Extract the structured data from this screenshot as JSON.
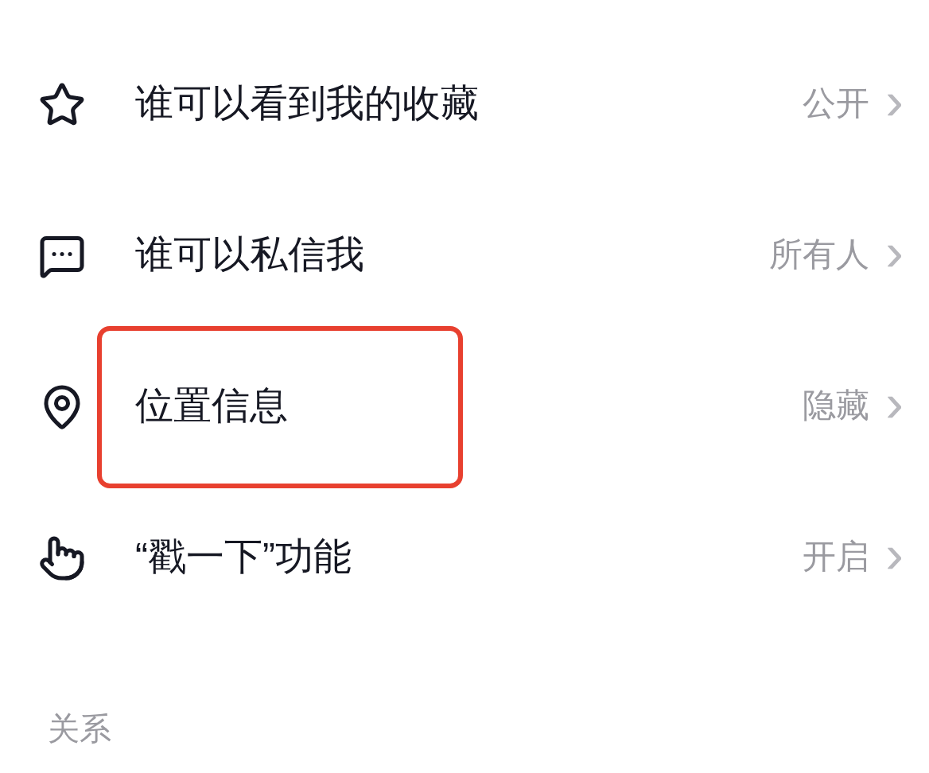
{
  "privacy_items": [
    {
      "kind": "star",
      "label": "谁可以看到我的收藏",
      "value": "公开",
      "chevron": "›",
      "highlighted": false
    },
    {
      "kind": "message",
      "label": "谁可以私信我",
      "value": "所有人",
      "chevron": "›",
      "highlighted": false
    },
    {
      "kind": "location",
      "label": "位置信息",
      "value": "隐藏",
      "chevron": "›",
      "highlighted": true
    },
    {
      "kind": "poke",
      "label": "“戳一下”功能",
      "value": "开启",
      "chevron": "›",
      "highlighted": false
    }
  ],
  "section_header": "关系"
}
